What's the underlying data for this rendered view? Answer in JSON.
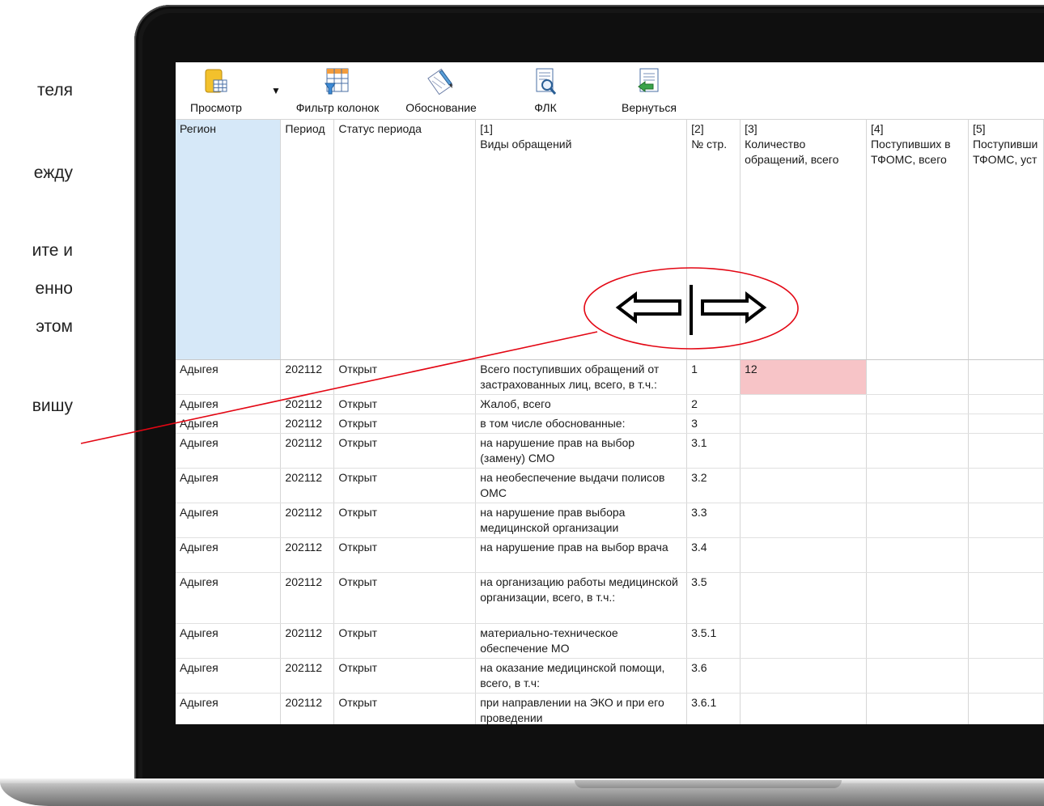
{
  "slide_text": [
    "теля",
    "ежду",
    "ите и",
    "енно",
    "этом",
    "вишу"
  ],
  "toolbar": {
    "buttons": [
      {
        "label": "Просмотр",
        "icon": "view-table-icon"
      },
      {
        "label": "Фильтр колонок",
        "icon": "column-filter-icon"
      },
      {
        "label": "Обоснование",
        "icon": "justification-icon"
      },
      {
        "label": "ФЛК",
        "icon": "flk-check-icon"
      },
      {
        "label": "Вернуться",
        "icon": "return-icon"
      }
    ],
    "dropdown_glyph": "▼"
  },
  "grid": {
    "headers": [
      {
        "l1": "Регион",
        "l2": "",
        "l3": ""
      },
      {
        "l1": "Период",
        "l2": "",
        "l3": ""
      },
      {
        "l1": "Статус периода",
        "l2": "",
        "l3": ""
      },
      {
        "l1": "[1]",
        "l2": "Виды обращений",
        "l3": ""
      },
      {
        "l1": "[2]",
        "l2": "№ стр.",
        "l3": ""
      },
      {
        "l1": "[3]",
        "l2": "Количество",
        "l3": "обращений, всего"
      },
      {
        "l1": "[4]",
        "l2": "Поступивших в",
        "l3": "ТФОМС, всего"
      },
      {
        "l1": "[5]",
        "l2": "Поступивши",
        "l3": "ТФОМС, уст"
      }
    ],
    "rows": [
      {
        "region": "Адыгея",
        "period": "202112",
        "status": "Открыт",
        "type": "Всего поступивших обращений от застрахованных лиц, всего, в т.ч.:",
        "num": "1",
        "c3": "12",
        "c4": "",
        "c5": ""
      },
      {
        "region": "Адыгея",
        "period": "202112",
        "status": "Открыт",
        "type": "Жалоб, всего",
        "num": "2",
        "c3": "",
        "c4": "",
        "c5": ""
      },
      {
        "region": "Адыгея",
        "period": "202112",
        "status": "Открыт",
        "type": "в том числе обоснованные:",
        "num": "3",
        "c3": "",
        "c4": "",
        "c5": ""
      },
      {
        "region": "Адыгея",
        "period": "202112",
        "status": "Открыт",
        "type": "на нарушение прав на выбор (замену) СМО",
        "num": "3.1",
        "c3": "",
        "c4": "",
        "c5": ""
      },
      {
        "region": "Адыгея",
        "period": "202112",
        "status": "Открыт",
        "type": "на необеспечение выдачи полисов ОМС",
        "num": "3.2",
        "c3": "",
        "c4": "",
        "c5": ""
      },
      {
        "region": "Адыгея",
        "period": "202112",
        "status": "Открыт",
        "type": "на нарушение прав выбора медицинской организации",
        "num": "3.3",
        "c3": "",
        "c4": "",
        "c5": ""
      },
      {
        "region": "Адыгея",
        "period": "202112",
        "status": "Открыт",
        "type": "на нарушение прав на выбор врача",
        "num": "3.4",
        "c3": "",
        "c4": "",
        "c5": ""
      },
      {
        "region": "Адыгея",
        "period": "202112",
        "status": "Открыт",
        "type": "на организацию работы медицинской организации, всего, в т.ч.:",
        "num": "3.5",
        "c3": "",
        "c4": "",
        "c5": ""
      },
      {
        "region": "Адыгея",
        "period": "202112",
        "status": "Открыт",
        "type": "материально-техническое обеспечение МО",
        "num": "3.5.1",
        "c3": "",
        "c4": "",
        "c5": ""
      },
      {
        "region": "Адыгея",
        "period": "202112",
        "status": "Открыт",
        "type": "на оказание медицинской помощи, всего, в т.ч:",
        "num": "3.6",
        "c3": "",
        "c4": "",
        "c5": ""
      },
      {
        "region": "Адыгея",
        "period": "202112",
        "status": "Открыт",
        "type": "при направлении на ЭКО и при его проведении",
        "num": "3.6.1",
        "c3": "",
        "c4": "",
        "c5": ""
      }
    ]
  },
  "annotation": {
    "icon": "column-resize-icon",
    "color": "#e30613"
  },
  "colors": {
    "selected_column": "#d6e8f8",
    "highlight_cell": "#f7c4c7"
  }
}
